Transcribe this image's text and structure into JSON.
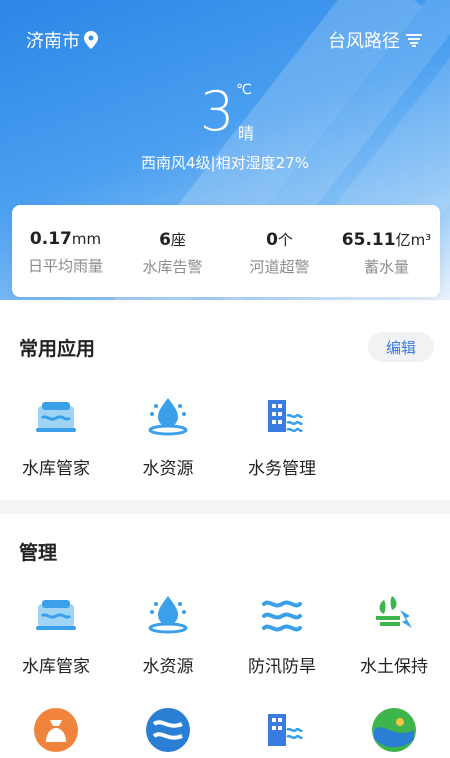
{
  "header": {
    "city": "济南市",
    "typhoon_label": "台风路径",
    "temperature": "3",
    "unit": "℃",
    "condition": "晴",
    "wind_humidity": "西南风4级|相对湿度27%"
  },
  "stats": [
    {
      "value": "0.17",
      "unit": "mm",
      "label": "日平均雨量"
    },
    {
      "value": "6",
      "unit": "座",
      "label": "水库告警"
    },
    {
      "value": "0",
      "unit": "个",
      "label": "河道超警"
    },
    {
      "value": "65.11",
      "unit": "亿m³",
      "label": "蓄水量"
    }
  ],
  "common_apps": {
    "title": "常用应用",
    "edit_label": "编辑",
    "items": [
      {
        "label": "水库管家",
        "icon": "reservoir-icon"
      },
      {
        "label": "水资源",
        "icon": "water-drop-icon"
      },
      {
        "label": "水务管理",
        "icon": "building-icon"
      }
    ]
  },
  "management": {
    "title": "管理",
    "items": [
      {
        "label": "水库管家",
        "icon": "reservoir-icon"
      },
      {
        "label": "水资源",
        "icon": "water-drop-icon"
      },
      {
        "label": "防汛防旱",
        "icon": "flood-waves-icon"
      },
      {
        "label": "水土保持",
        "icon": "soil-conservation-icon"
      }
    ],
    "more_icons": [
      "money-bag-icon",
      "river-logo-icon",
      "building-icon",
      "wave-globe-icon"
    ]
  },
  "colors": {
    "primary": "#3aa0ea",
    "accent_blue": "#3a7be0",
    "green": "#3db54a"
  }
}
